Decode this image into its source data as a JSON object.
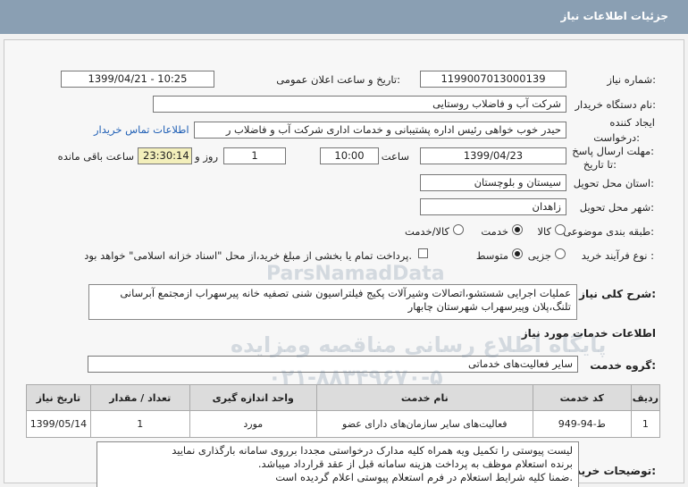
{
  "page_title": "جزئیات اطلاعات نیاز",
  "fields": {
    "need_number_label": "شماره نیاز:",
    "need_number": "1199007013000139",
    "announce_label": "تاریخ و ساعت اعلان عمومی:",
    "announce_value": "1399/04/21 - 10:25",
    "buyer_org_label": "نام دستگاه خریدار:",
    "buyer_org": "شرکت آب و فاضلاب روستایی",
    "creator_label_1": "ایجاد کننده",
    "creator_label_2": "درخواست:",
    "creator": "حیدر خوب خواهی  رئیس اداره پشتیبانی و خدمات اداری  شرکت آب و فاضلاب ر",
    "contact_link": "اطلاعات تماس خریدار",
    "deadline_label_1": "مهلت ارسال پاسخ:",
    "deadline_label_2": "تا تاریخ:",
    "deadline_date": "1399/04/23",
    "time_label": "ساعت",
    "deadline_time": "10:00",
    "days_value": "1",
    "days_label": "روز و",
    "remaining_time": "23:30:14",
    "remaining_label": "ساعت باقی مانده",
    "province_label": "استان محل تحویل:",
    "province": "سیستان و بلوچستان",
    "city_label": "شهر محل تحویل:",
    "city": "زاهدان",
    "category_label": "طبقه بندی موضوعی:",
    "category_options": [
      "کالا",
      "خدمت",
      "کالا/خدمت"
    ],
    "purchase_type_label": "نوع فرآیند خرید :",
    "purchase_type_options": [
      "جزیی",
      "متوسط"
    ],
    "payment_note": "پرداخت تمام یا بخشی از مبلغ خرید،از محل \"اسناد خزانه اسلامی\" خواهد بود."
  },
  "summary": {
    "label": "شرح کلی نیاز:",
    "text_line1": "عملیات  اجرایی  شستشو،اتصالات وشیرآلات پکیج فیلتراسیون شنی تصفیه خانه پیرسهراب ازمجتمع آبرسانی",
    "text_line2": "تلنگ،پلان وپیرسهراب  شهرستان چابهار"
  },
  "services": {
    "section_title": "اطلاعات خدمات مورد نیاز",
    "group_label": "گروه خدمت:",
    "group_value": "سایر فعالیت‌های خدماتی",
    "columns": [
      "ردیف",
      "کد خدمت",
      "نام خدمت",
      "واحد اندازه گیری",
      "تعداد / مقدار",
      "تاریخ نیاز"
    ],
    "rows": [
      [
        "1",
        "ط-94-949",
        "فعالیت‌های سایر سازمان‌های دارای عضو",
        "مورد",
        "1",
        "1399/05/14"
      ]
    ]
  },
  "buyer_notes": {
    "label": "توضیحات خریدار:",
    "lines": [
      "لیست پیوستی را تکمیل ویه همراه کلیه مدارک درخواستی مجددا برروی سامانه بارگذاری نمایید",
      "برنده استعلام موظف به پرداخت هزینه سامانه قبل از عقد قرارداد میباشد.",
      ".ضمنا کلیه شرایط استعلام در فرم استعلام پیوستی اعلام گردیده است"
    ]
  },
  "watermark": {
    "brand": "ParsNamadData",
    "line1": "پایگاه اطلاع رسانی مناقصه ومزایده",
    "line2": "۰۲۱-۸۸۳۴۹۶۷۰-۵"
  }
}
